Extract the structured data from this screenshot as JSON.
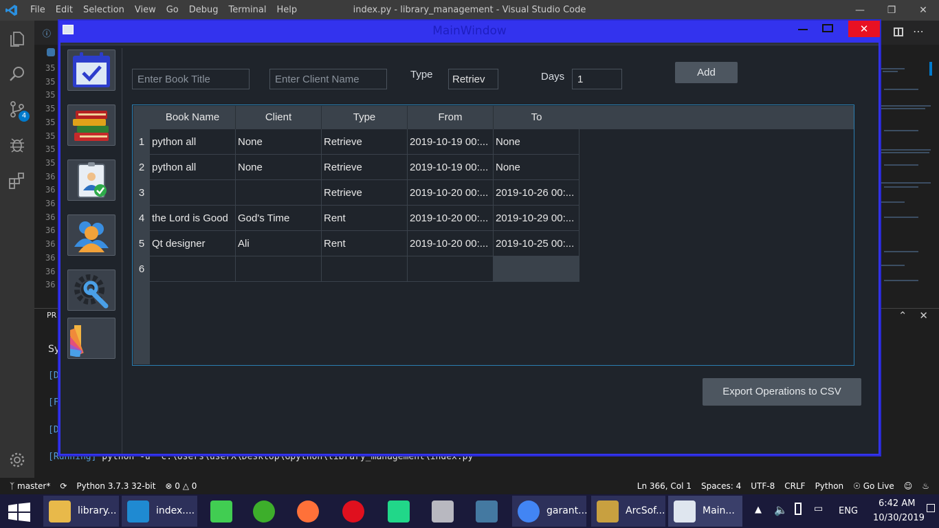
{
  "vscode": {
    "menu": [
      "File",
      "Edit",
      "Selection",
      "View",
      "Go",
      "Debug",
      "Terminal",
      "Help"
    ],
    "title": "index.py - library_management - Visual Studio Code",
    "line_numbers": [
      "35",
      "35",
      "35",
      "35",
      "35",
      "35",
      "35",
      "35",
      "36",
      "36",
      "36",
      "36",
      "36",
      "36",
      "36",
      "36",
      "36"
    ],
    "panel_head": "PR",
    "terminal_lines": [
      "Sy",
      "[D",
      "[F",
      "[D"
    ],
    "running_tag": "[Running]",
    "running_cmd": "python -u \"c:\\Users\\userX\\Desktop\\Gpython\\library_management\\index.py\"",
    "scm_badge": "4",
    "status_left": {
      "branch": "master*",
      "python": "Python 3.7.3 32-bit",
      "errors": "0",
      "warnings": "0"
    },
    "status_right": [
      "Ln 366, Col 1",
      "Spaces: 4",
      "UTF-8",
      "CRLF",
      "Python",
      "Go Live"
    ]
  },
  "window": {
    "title": "MainWindow",
    "close_symbol": "✕"
  },
  "form": {
    "book_title_placeholder": "Enter Book Title",
    "client_name_placeholder": "Enter Client Name",
    "type_label": "Type",
    "type_value": "Retriev",
    "days_label": "Days",
    "days_value": "1",
    "add_label": "Add",
    "export_label": "Export Operations  to CSV"
  },
  "table": {
    "headers": [
      "Book Name",
      "Client",
      "Type",
      "From",
      "To"
    ],
    "rows": [
      {
        "num": "1",
        "book": "python all",
        "client": "None",
        "type": "Retrieve",
        "from": "2019-10-19 00:...",
        "to": "None"
      },
      {
        "num": "2",
        "book": "python all",
        "client": "None",
        "type": "Retrieve",
        "from": "2019-10-19 00:...",
        "to": "None"
      },
      {
        "num": "3",
        "book": "",
        "client": "",
        "type": "Retrieve",
        "from": "2019-10-20 00:...",
        "to": "2019-10-26 00:..."
      },
      {
        "num": "4",
        "book": "the Lord is Good",
        "client": "God's Time",
        "type": "Rent",
        "from": "2019-10-20 00:...",
        "to": "2019-10-29 00:..."
      },
      {
        "num": "5",
        "book": "Qt designer",
        "client": "Ali",
        "type": "Rent",
        "from": "2019-10-20 00:...",
        "to": "2019-10-25 00:..."
      },
      {
        "num": "6",
        "book": "",
        "client": "",
        "type": "",
        "from": "",
        "to": ""
      }
    ]
  },
  "taskbar": {
    "items": [
      {
        "label": "library...",
        "icon": "folder-icon",
        "color": "#e8b94a"
      },
      {
        "label": "index....",
        "icon": "vscode-icon",
        "color": "#1f8ad2"
      },
      {
        "label": "",
        "icon": "qt-icon",
        "color": "#41cd52"
      },
      {
        "label": "",
        "icon": "green-app-icon",
        "color": "#3dae2b"
      },
      {
        "label": "",
        "icon": "firefox-icon",
        "color": "#ff7139"
      },
      {
        "label": "",
        "icon": "opera-icon",
        "color": "#e0101e"
      },
      {
        "label": "",
        "icon": "pycharm-icon",
        "color": "#21d789"
      },
      {
        "label": "",
        "icon": "database-icon",
        "color": "#b8b8c0"
      },
      {
        "label": "",
        "icon": "mysql-icon",
        "color": "#4479a1"
      },
      {
        "label": "garant...",
        "icon": "chrome-icon",
        "color": "#4285f4"
      },
      {
        "label": "ArcSof...",
        "icon": "arcsoft-icon",
        "color": "#c8a040"
      },
      {
        "label": "Main...",
        "icon": "mainwindow-icon",
        "color": "#dfe6ef"
      }
    ],
    "tray_lang": "ENG",
    "time": "6:42 AM",
    "date": "10/30/2019"
  }
}
